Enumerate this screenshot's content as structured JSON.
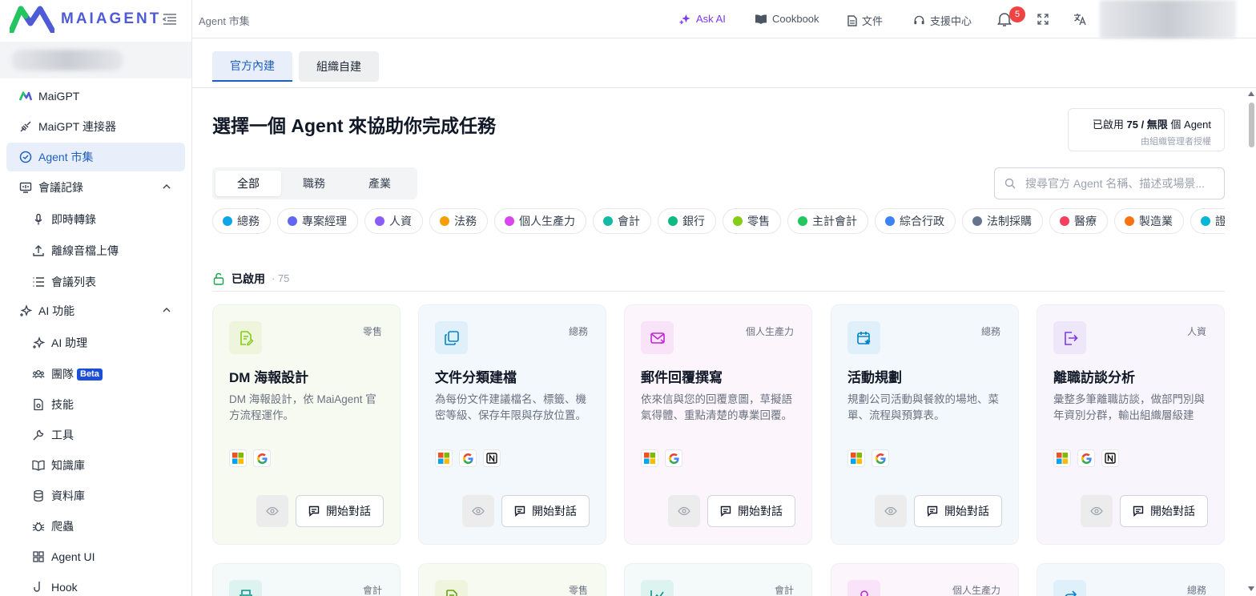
{
  "app": {
    "brand": "MAIAGENT",
    "breadcrumb": "Agent 市集"
  },
  "header": {
    "ask_ai": "Ask AI",
    "cookbook": "Cookbook",
    "docs": "文件",
    "support": "支援中心",
    "notifications": "5"
  },
  "sidebar": {
    "items": [
      {
        "label": "MaiGPT",
        "icon": "maiagent-logo-icon"
      },
      {
        "label": "MaiGPT 連接器",
        "icon": "plug-icon"
      },
      {
        "label": "Agent 市集",
        "icon": "badge-check-icon",
        "active": true
      },
      {
        "label": "會議記錄",
        "icon": "meeting-icon",
        "expandable": true
      },
      {
        "label": "即時轉錄",
        "icon": "microphone-icon"
      },
      {
        "label": "離線音檔上傳",
        "icon": "upload-icon"
      },
      {
        "label": "會議列表",
        "icon": "list-icon"
      },
      {
        "label": "AI 功能",
        "icon": "sparkles-icon",
        "expandable": true
      },
      {
        "label": "AI 助理",
        "icon": "sparkles-icon"
      },
      {
        "label": "團隊",
        "icon": "users-icon",
        "badge": "Beta"
      },
      {
        "label": "技能",
        "icon": "file-icon"
      },
      {
        "label": "工具",
        "icon": "wrench-icon"
      },
      {
        "label": "知識庫",
        "icon": "book-icon"
      },
      {
        "label": "資料庫",
        "icon": "database-icon"
      },
      {
        "label": "爬蟲",
        "icon": "bug-icon"
      },
      {
        "label": "Agent UI",
        "icon": "grid-icon"
      },
      {
        "label": "Hook",
        "icon": "hook-icon"
      }
    ]
  },
  "main": {
    "tabs": [
      {
        "label": "官方內建",
        "active": true
      },
      {
        "label": "組織自建",
        "active": false
      }
    ],
    "title": "選擇一個 Agent 來協助你完成任務",
    "quota_prefix": "已啟用 ",
    "quota_used": "75 / 無限",
    "quota_suffix": " 個 Agent",
    "quota_note": "由組織管理者授權",
    "filters": [
      {
        "label": "全部",
        "active": true
      },
      {
        "label": "職務"
      },
      {
        "label": "產業"
      }
    ],
    "search_placeholder": "搜尋官方 Agent 名稱、描述或場景...",
    "categories": [
      {
        "label": "總務",
        "color": "#0ea5e9"
      },
      {
        "label": "專案經理",
        "color": "#6366f1"
      },
      {
        "label": "人資",
        "color": "#8b5cf6"
      },
      {
        "label": "法務",
        "color": "#f59e0b"
      },
      {
        "label": "個人生產力",
        "color": "#d946ef"
      },
      {
        "label": "會計",
        "color": "#14b8a6"
      },
      {
        "label": "銀行",
        "color": "#10b981"
      },
      {
        "label": "零售",
        "color": "#84cc16"
      },
      {
        "label": "主計會計",
        "color": "#22c55e"
      },
      {
        "label": "綜合行政",
        "color": "#3b82f6"
      },
      {
        "label": "法制採購",
        "color": "#64748b"
      },
      {
        "label": "醫療",
        "color": "#f43f5e"
      },
      {
        "label": "製造業",
        "color": "#f97316"
      },
      {
        "label": "證券",
        "color": "#06b6d4"
      }
    ],
    "enabled_label": "已啟用",
    "enabled_count": "· 75",
    "start_label": "開始對話",
    "cards": [
      {
        "name": "DM 海報設計",
        "tag": "零售",
        "desc": "DM 海報設計，依 MaiAgent 官方流程運作。",
        "bg": "#f7faf1",
        "icon_bg": "#eef5dc",
        "icon_color": "#84cc16",
        "icon": "document-edit-icon",
        "logos": [
          "microsoft-logo-icon",
          "google-logo-icon"
        ]
      },
      {
        "name": "文件分類建檔",
        "tag": "總務",
        "desc": "為每份文件建議檔名、標籤、機密等級、保存年限與存放位置。",
        "bg": "#f3f8fc",
        "icon_bg": "#dff0fa",
        "icon_color": "#0284c7",
        "icon": "folder-copy-icon",
        "logos": [
          "microsoft-logo-icon",
          "google-logo-icon",
          "notion-logo-icon"
        ]
      },
      {
        "name": "郵件回覆撰寫",
        "tag": "個人生產力",
        "desc": "依來信與您的回覆意圖，草擬語氣得體、重點清楚的專業回覆。",
        "bg": "#fcf5fc",
        "icon_bg": "#f8e3f8",
        "icon_color": "#c026d3",
        "icon": "mail-icon",
        "logos": [
          "microsoft-logo-icon",
          "google-logo-icon"
        ]
      },
      {
        "name": "活動規劃",
        "tag": "總務",
        "desc": "規劃公司活動與餐敘的場地、菜單、流程與預算表。",
        "bg": "#f3f8fc",
        "icon_bg": "#dff0fa",
        "icon_color": "#0284c7",
        "icon": "calendar-star-icon",
        "logos": [
          "microsoft-logo-icon",
          "google-logo-icon"
        ]
      },
      {
        "name": "離職訪談分析",
        "tag": "人資",
        "desc": "彙整多筆離職訪談，做部門別與年資別分群，輸出組織層級建議。",
        "bg": "#f8f6fc",
        "icon_bg": "#ede7f9",
        "icon_color": "#7c3aed",
        "icon": "exit-door-icon",
        "logos": [
          "microsoft-logo-icon",
          "google-logo-icon",
          "notion-logo-icon"
        ]
      }
    ],
    "next_cards": [
      {
        "tag": "會計",
        "icon_bg": "#dcf3ef",
        "icon_color": "#0d9488",
        "icon": "printer-icon",
        "bg": "#f3faf9"
      },
      {
        "tag": "零售",
        "icon_bg": "#eef5dc",
        "icon_color": "#65a30d",
        "icon": "document-edit-icon",
        "bg": "#f7faf1"
      },
      {
        "tag": "會計",
        "icon_bg": "#dcf3ef",
        "icon_color": "#0d9488",
        "icon": "chart-line-icon",
        "bg": "#f3faf9"
      },
      {
        "tag": "個人生產力",
        "icon_bg": "#f8e3f8",
        "icon_color": "#c026d3",
        "icon": "user-icon",
        "bg": "#fcf5fc"
      },
      {
        "tag": "總務",
        "icon_bg": "#dff0fa",
        "icon_color": "#0284c7",
        "icon": "share-icon",
        "bg": "#f3f8fc"
      }
    ]
  }
}
